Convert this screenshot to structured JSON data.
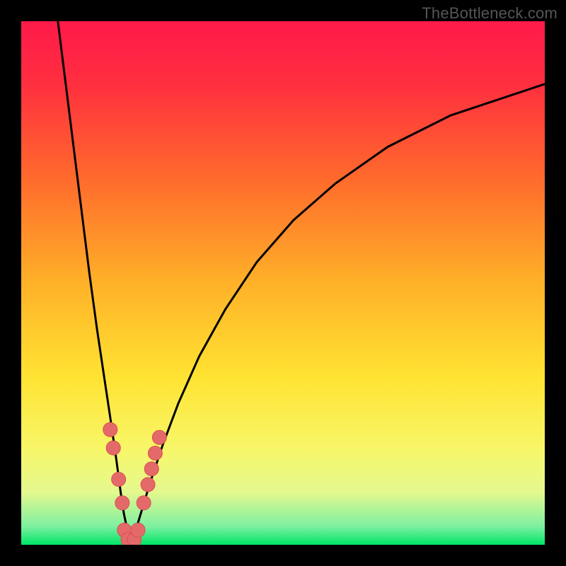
{
  "watermark": "TheBottleneck.com",
  "chart_data": {
    "type": "line",
    "title": "",
    "xlabel": "",
    "ylabel": "",
    "xlim": [
      0,
      100
    ],
    "ylim": [
      0,
      100
    ],
    "grid": false,
    "legend": false,
    "gradient_stops": [
      {
        "offset": 0.0,
        "color": "#ff1a4a"
      },
      {
        "offset": 0.12,
        "color": "#ff2f3f"
      },
      {
        "offset": 0.3,
        "color": "#ff6a2c"
      },
      {
        "offset": 0.5,
        "color": "#ffb128"
      },
      {
        "offset": 0.68,
        "color": "#ffe332"
      },
      {
        "offset": 0.82,
        "color": "#f7f76a"
      },
      {
        "offset": 0.9,
        "color": "#e4f88f"
      },
      {
        "offset": 0.965,
        "color": "#7df0a0"
      },
      {
        "offset": 1.0,
        "color": "#00e566"
      }
    ],
    "curve_left": {
      "name": "left-branch",
      "x": [
        7.0,
        8.5,
        10.0,
        11.5,
        13.0,
        14.5,
        16.0,
        17.2,
        18.2,
        19.0,
        19.6,
        20.1,
        20.5,
        20.9
      ],
      "y": [
        100,
        88,
        76,
        64,
        52,
        41,
        31,
        23,
        16,
        10,
        6,
        3.6,
        1.8,
        0.6
      ]
    },
    "curve_right": {
      "name": "right-branch",
      "x": [
        21.1,
        21.5,
        22.0,
        23.0,
        24.5,
        27.0,
        30.0,
        34.0,
        39.0,
        45.0,
        52.0,
        60.0,
        70.0,
        82.0,
        94.0,
        100.0
      ],
      "y": [
        0.6,
        1.6,
        3.2,
        6.5,
        11.5,
        19.0,
        27.0,
        36.0,
        45.0,
        54.0,
        62.0,
        69.0,
        76.0,
        82.0,
        86.0,
        88.0
      ]
    },
    "vertex": {
      "x": 21.0,
      "y": 0.0
    },
    "markers": [
      {
        "x": 17.0,
        "y": 22.0
      },
      {
        "x": 17.6,
        "y": 18.5
      },
      {
        "x": 18.6,
        "y": 12.5
      },
      {
        "x": 19.3,
        "y": 8.0
      },
      {
        "x": 19.7,
        "y": 2.8
      },
      {
        "x": 20.4,
        "y": 1.0
      },
      {
        "x": 21.6,
        "y": 1.0
      },
      {
        "x": 22.3,
        "y": 2.8
      },
      {
        "x": 23.4,
        "y": 8.0
      },
      {
        "x": 24.2,
        "y": 11.5
      },
      {
        "x": 24.9,
        "y": 14.5
      },
      {
        "x": 25.6,
        "y": 17.5
      },
      {
        "x": 26.4,
        "y": 20.5
      }
    ],
    "marker_style": {
      "r": 10,
      "fill": "#e46a6a",
      "stroke": "#d94f4f"
    }
  }
}
